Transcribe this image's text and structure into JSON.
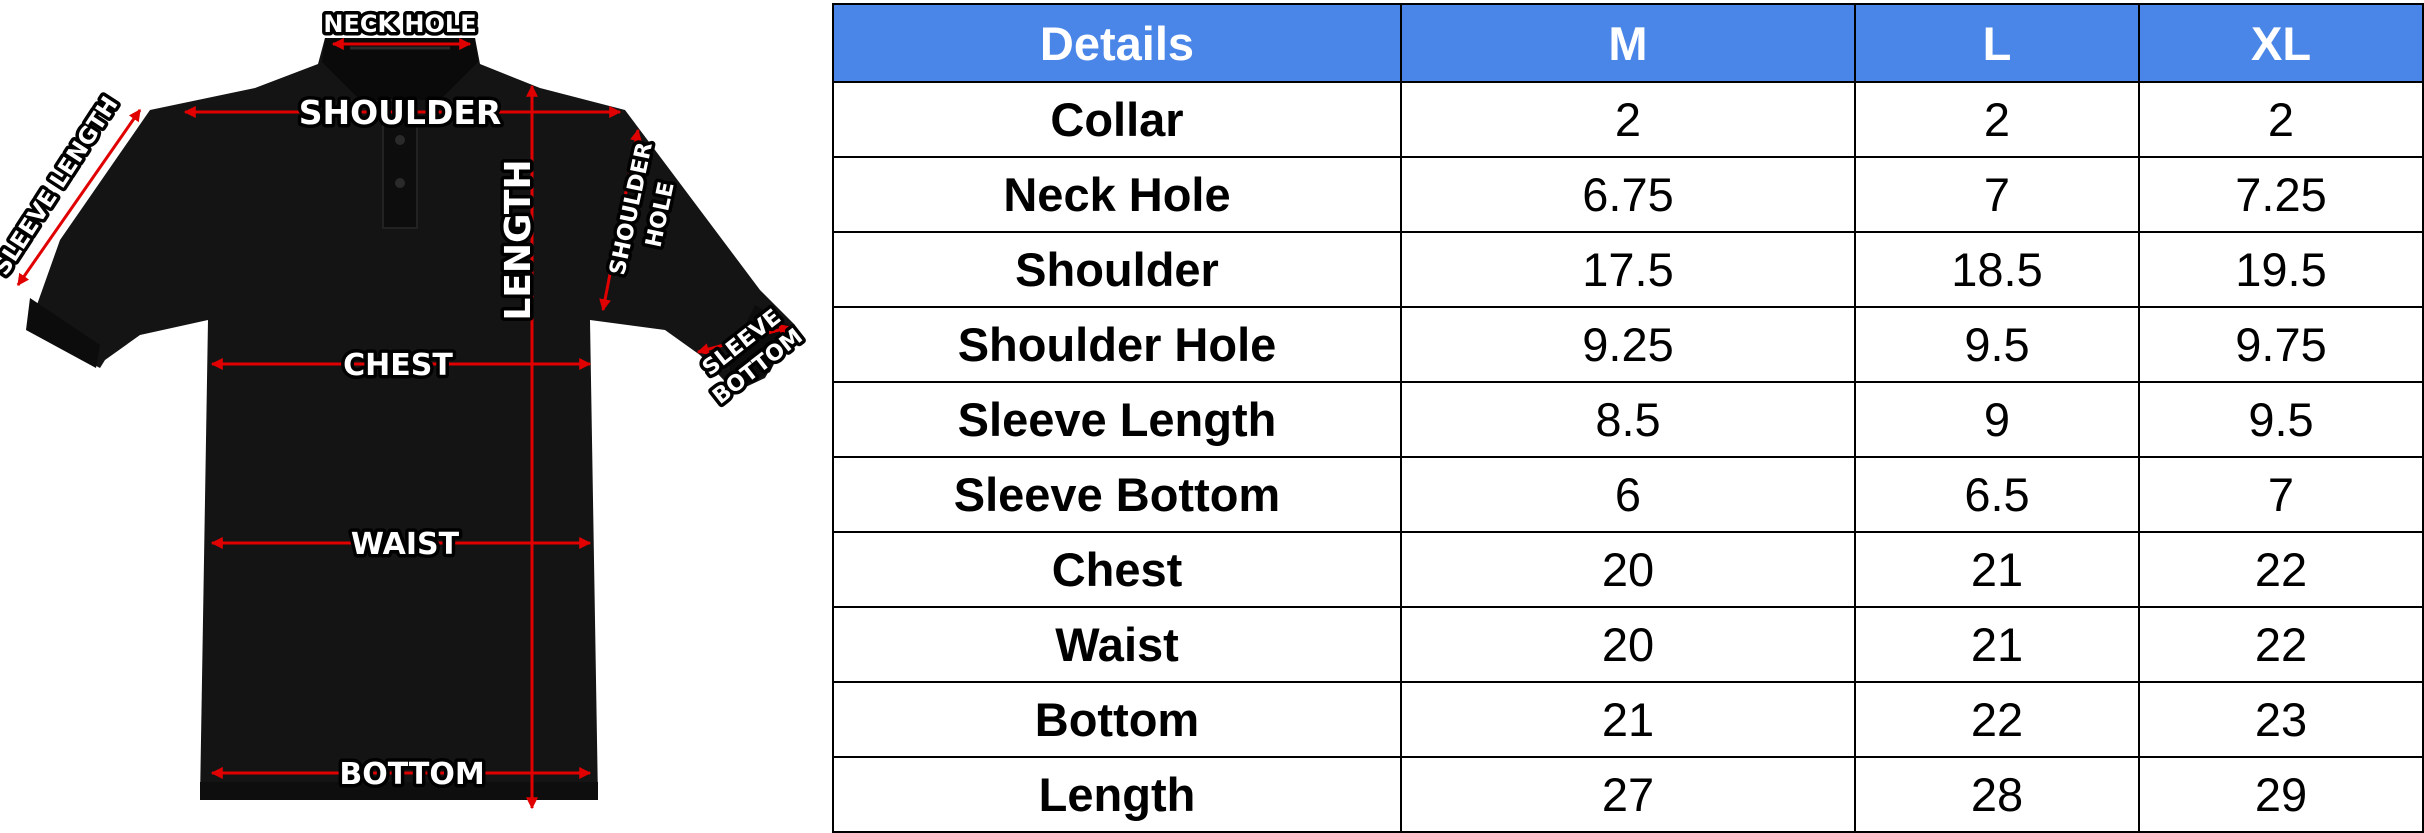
{
  "diagram": {
    "labels": {
      "neck_hole": "NECK HOLE",
      "shoulder": "SHOULDER",
      "sleeve_length": "SLEEVE LENGTH",
      "length": "LENGTH",
      "shoulder_hole_1": "SHOULDER",
      "shoulder_hole_2": "HOLE",
      "sleeve_bottom_1": "SLEEVE",
      "sleeve_bottom_2": "BOTTOM",
      "chest": "CHEST",
      "waist": "WAIST",
      "bottom": "BOTTOM"
    },
    "colors": {
      "shirt": "#141414",
      "arrows": "#e00000",
      "header": "#4a86e8"
    }
  },
  "table": {
    "headers": [
      "Details",
      "M",
      "L",
      "XL"
    ],
    "rows": [
      {
        "label": "Collar",
        "m": "2",
        "l": "2",
        "xl": "2"
      },
      {
        "label": "Neck Hole",
        "m": "6.75",
        "l": "7",
        "xl": "7.25"
      },
      {
        "label": "Shoulder",
        "m": "17.5",
        "l": "18.5",
        "xl": "19.5"
      },
      {
        "label": "Shoulder Hole",
        "m": "9.25",
        "l": "9.5",
        "xl": "9.75"
      },
      {
        "label": "Sleeve Length",
        "m": "8.5",
        "l": "9",
        "xl": "9.5"
      },
      {
        "label": "Sleeve Bottom",
        "m": "6",
        "l": "6.5",
        "xl": "7"
      },
      {
        "label": "Chest",
        "m": "20",
        "l": "21",
        "xl": "22"
      },
      {
        "label": "Waist",
        "m": "20",
        "l": "21",
        "xl": "22"
      },
      {
        "label": "Bottom",
        "m": "21",
        "l": "22",
        "xl": "23"
      },
      {
        "label": "Length",
        "m": "27",
        "l": "28",
        "xl": "29"
      }
    ]
  }
}
